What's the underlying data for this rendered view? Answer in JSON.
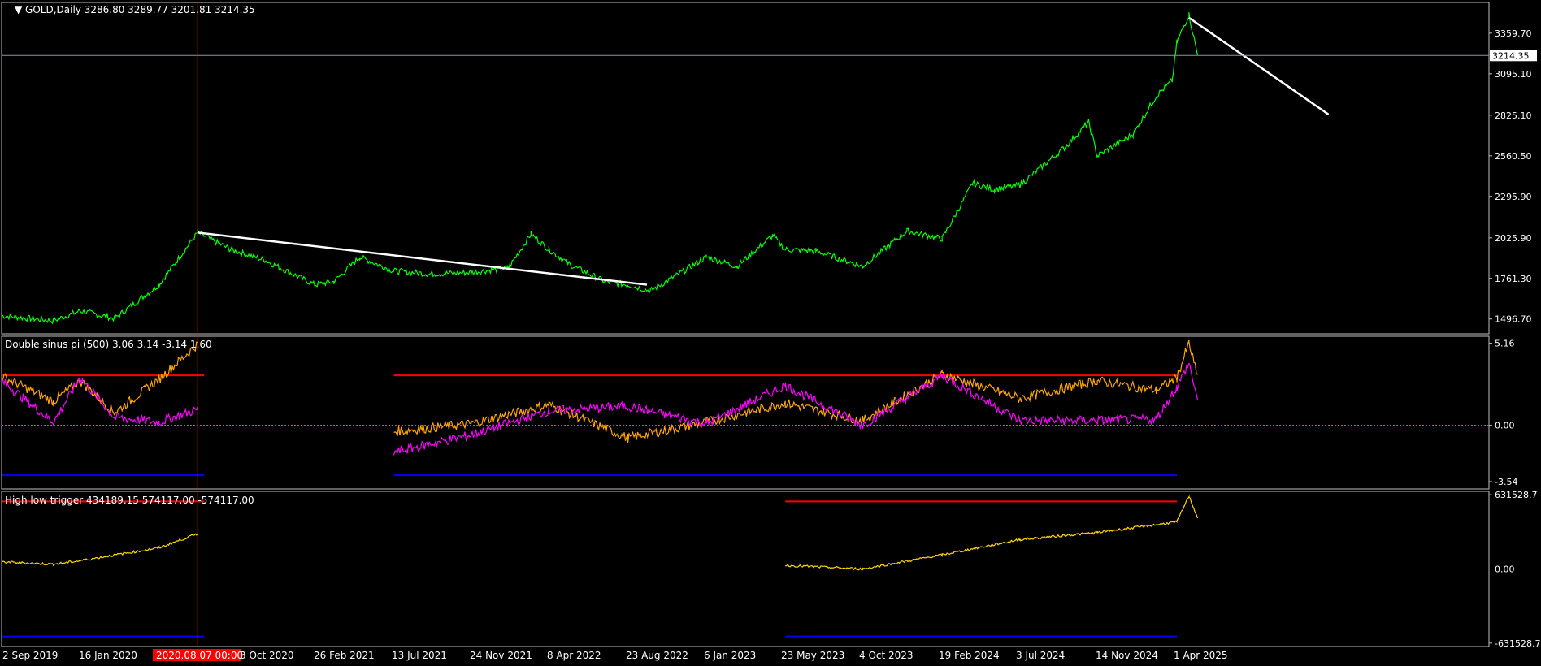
{
  "header": {
    "symbol": "GOLD,Daily",
    "ohlc": "3286.80 3289.77 3201.81 3214.35"
  },
  "colors": {
    "background": "#000000",
    "frame": "#c0c0c0",
    "price_line": "#00ff00",
    "trend_line": "#ffffff",
    "orange": "#ffa500",
    "magenta": "#ff00ff",
    "yellow": "#ffd700",
    "level_high": "#ff0000",
    "level_low": "#0000ff",
    "zero_line": "#b8860b",
    "cursor": "#ff0000"
  },
  "x_axis": {
    "labels": [
      "2 Sep 2019",
      "16 Jan 2020",
      "3 Oct 2020",
      "26 Feb 2021",
      "13 Jul 2021",
      "24 Nov 2021",
      "8 Apr 2022",
      "23 Aug 2022",
      "6 Jan 2023",
      "23 May 2023",
      "4 Oct 2023",
      "19 Feb 2024",
      "3 Jul 2024",
      "14 Nov 2024",
      "1 Apr 2025"
    ],
    "cursor_label": "2020.08.07 00:00"
  },
  "chart_data": [
    {
      "type": "line",
      "title": "GOLD,Daily",
      "x": [
        "2019-09-02",
        "2019-12-01",
        "2020-01-16",
        "2020-03-16",
        "2020-06-01",
        "2020-08-07",
        "2020-10-03",
        "2020-12-01",
        "2021-02-26",
        "2021-03-31",
        "2021-05-15",
        "2021-07-13",
        "2021-09-15",
        "2021-11-24",
        "2022-01-28",
        "2022-03-08",
        "2022-04-08",
        "2022-05-15",
        "2022-07-15",
        "2022-08-23",
        "2022-10-01",
        "2022-11-15",
        "2023-01-06",
        "2023-02-28",
        "2023-05-01",
        "2023-05-23",
        "2023-07-15",
        "2023-10-04",
        "2023-12-20",
        "2024-02-19",
        "2024-04-12",
        "2024-05-20",
        "2024-07-03",
        "2024-09-20",
        "2024-10-30",
        "2024-11-14",
        "2025-01-15",
        "2025-02-24",
        "2025-03-24",
        "2025-04-01",
        "2025-04-22",
        "2025-05-07"
      ],
      "series": [
        {
          "values": [
            1518,
            1485,
            1550,
            1500,
            1720,
            2060,
            1950,
            1880,
            1720,
            1740,
            1900,
            1810,
            1790,
            1800,
            1830,
            2050,
            1950,
            1850,
            1740,
            1720,
            1680,
            1780,
            1900,
            1840,
            2040,
            1950,
            1940,
            1840,
            2070,
            2020,
            2380,
            2340,
            2370,
            2620,
            2780,
            2560,
            2700,
            2950,
            3050,
            3300,
            3480,
            3214.35
          ]
        }
      ],
      "trend_lines": [
        {
          "from": [
            "2020-08-07",
            2060
          ],
          "to": [
            "2022-09-25",
            1720
          ]
        },
        {
          "from": [
            "2025-04-22",
            3460
          ],
          "to": [
            "2025-12-20",
            2830
          ]
        }
      ],
      "current_price": 3214.35,
      "y_ticks": [
        3359.7,
        3095.1,
        2825.1,
        2560.5,
        2295.9,
        2025.9,
        1761.3,
        1496.7
      ],
      "ylim": [
        1400,
        3560
      ],
      "grid": false
    },
    {
      "type": "line",
      "title": "Double sinus pi (500) 3.06 3.14 -3.14 1.60",
      "x": [
        "2019-09-02",
        "2019-12-01",
        "2020-01-16",
        "2020-03-16",
        "2020-06-01",
        "2020-08-07",
        "2021-07-13",
        "2021-11-24",
        "2022-04-08",
        "2022-08-23",
        "2023-01-06",
        "2023-05-23",
        "2023-10-04",
        "2024-02-19",
        "2024-07-03",
        "2024-11-14",
        "2025-02-24",
        "2025-04-01",
        "2025-04-22",
        "2025-05-07"
      ],
      "series": [
        {
          "values": [
            3.1,
            1.5,
            2.8,
            0.8,
            2.9,
            5.1,
            -0.4,
            0.1,
            1.3,
            -0.8,
            0.2,
            1.4,
            0.3,
            3.2,
            1.7,
            2.8,
            2.2,
            3.0,
            5.16,
            3.0
          ]
        },
        {
          "values": [
            2.8,
            0.2,
            3.0,
            0.5,
            0.2,
            1.0,
            -1.7,
            -0.6,
            0.9,
            1.2,
            0.1,
            2.5,
            0.0,
            3.1,
            0.3,
            0.3,
            0.4,
            2.4,
            3.9,
            1.6
          ]
        }
      ],
      "levels": [
        3.14,
        0,
        -3.14
      ],
      "y_ticks": [
        5.16,
        0.0,
        -3.54
      ],
      "ylim": [
        -4.0,
        5.6
      ],
      "grid": false
    },
    {
      "type": "line",
      "title": "High low trigger 434189.15 574117.00 -574117.00",
      "x": [
        "2019-09-02",
        "2019-12-01",
        "2020-01-16",
        "2020-06-01",
        "2020-08-07",
        "2023-05-23",
        "2023-10-04",
        "2024-02-19",
        "2024-07-03",
        "2024-11-14",
        "2025-04-01",
        "2025-04-22",
        "2025-05-07"
      ],
      "series": [
        {
          "values": [
            60000,
            40000,
            70000,
            180000,
            300000,
            30000,
            0,
            120000,
            250000,
            310000,
            400000,
            620000,
            434189.15
          ]
        }
      ],
      "levels": [
        574117.0,
        0,
        -574117.0
      ],
      "y_ticks": [
        631528.7,
        0.0,
        -631528.7
      ],
      "ylim": [
        -660000,
        660000
      ],
      "grid": false
    }
  ]
}
